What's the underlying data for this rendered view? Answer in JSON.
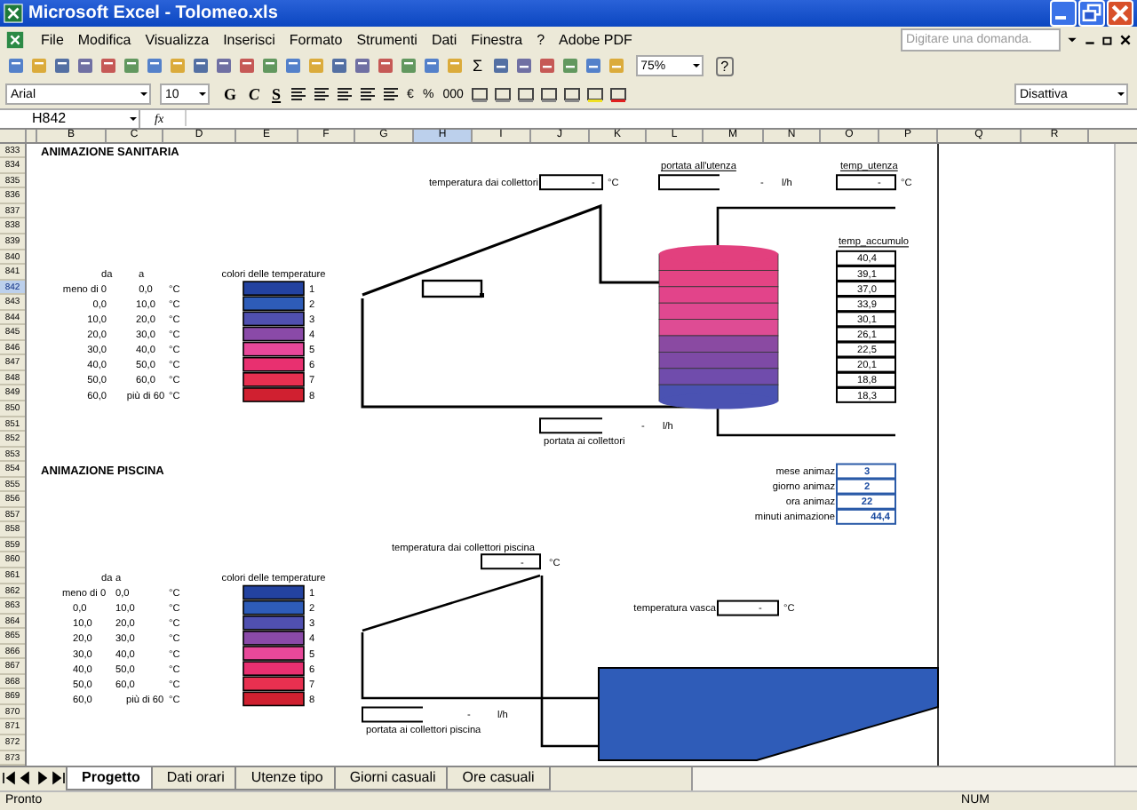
{
  "window": {
    "title": "Microsoft Excel - Tolomeo.xls"
  },
  "menu": [
    "File",
    "Modifica",
    "Visualizza",
    "Inserisci",
    "Formato",
    "Strumenti",
    "Dati",
    "Finestra",
    "?",
    "Adobe PDF"
  ],
  "help_search": {
    "placeholder": "Digitare una domanda."
  },
  "toolbar": {
    "sum": "Σ",
    "zoom": "75%",
    "help": "?"
  },
  "format_toolbar": {
    "font": "Arial",
    "size": "10",
    "styles": [
      "G",
      "C",
      "S"
    ],
    "number_formats": [
      "€",
      "%",
      "000"
    ],
    "style_box": "Disattiva"
  },
  "formula_bar": {
    "name_box": "H842",
    "fx": "fx"
  },
  "columns": [
    {
      "label": "B",
      "selected": false
    },
    {
      "label": "C",
      "selected": false
    },
    {
      "label": "D",
      "selected": false
    },
    {
      "label": "E",
      "selected": false
    },
    {
      "label": "F",
      "selected": false
    },
    {
      "label": "G",
      "selected": false
    },
    {
      "label": "H",
      "selected": true
    },
    {
      "label": "I",
      "selected": false
    },
    {
      "label": "J",
      "selected": false
    },
    {
      "label": "K",
      "selected": false
    },
    {
      "label": "L",
      "selected": false
    },
    {
      "label": "M",
      "selected": false
    },
    {
      "label": "N",
      "selected": false
    },
    {
      "label": "O",
      "selected": false
    },
    {
      "label": "P",
      "selected": false
    },
    {
      "label": "Q",
      "selected": false
    },
    {
      "label": "R",
      "selected": false
    }
  ],
  "rows": [
    {
      "label": "833",
      "selected": false
    },
    {
      "label": "834",
      "selected": false
    },
    {
      "label": "835",
      "selected": false
    },
    {
      "label": "836",
      "selected": false
    },
    {
      "label": "837",
      "selected": false
    },
    {
      "label": "838",
      "selected": false
    },
    {
      "label": "839",
      "selected": false
    },
    {
      "label": "840",
      "selected": false
    },
    {
      "label": "841",
      "selected": false
    },
    {
      "label": "842",
      "selected": true
    },
    {
      "label": "843",
      "selected": false
    },
    {
      "label": "844",
      "selected": false
    },
    {
      "label": "845",
      "selected": false
    },
    {
      "label": "846",
      "selected": false
    },
    {
      "label": "847",
      "selected": false
    },
    {
      "label": "848",
      "selected": false
    },
    {
      "label": "849",
      "selected": false
    },
    {
      "label": "850",
      "selected": false
    },
    {
      "label": "851",
      "selected": false
    },
    {
      "label": "852",
      "selected": false
    },
    {
      "label": "853",
      "selected": false
    },
    {
      "label": "854",
      "selected": false
    },
    {
      "label": "855",
      "selected": false
    },
    {
      "label": "856",
      "selected": false
    },
    {
      "label": "857",
      "selected": false
    },
    {
      "label": "858",
      "selected": false
    },
    {
      "label": "859",
      "selected": false
    },
    {
      "label": "860",
      "selected": false
    },
    {
      "label": "861",
      "selected": false
    },
    {
      "label": "862",
      "selected": false
    },
    {
      "label": "863",
      "selected": false
    },
    {
      "label": "864",
      "selected": false
    },
    {
      "label": "865",
      "selected": false
    },
    {
      "label": "866",
      "selected": false
    },
    {
      "label": "867",
      "selected": false
    },
    {
      "label": "868",
      "selected": false
    },
    {
      "label": "869",
      "selected": false
    },
    {
      "label": "870",
      "selected": false
    },
    {
      "label": "871",
      "selected": false
    },
    {
      "label": "872",
      "selected": false
    },
    {
      "label": "873",
      "selected": false
    }
  ],
  "sanitaria": {
    "title": "ANIMAZIONE SANITARIA",
    "legend": {
      "from_header": "da",
      "to_header": "a",
      "colors_header": "colori delle temperature",
      "ranges": [
        {
          "from": "meno di 0",
          "to": "0,0",
          "unit": "°C",
          "index": "1",
          "color": "#2342a0"
        },
        {
          "from": "0,0",
          "to": "10,0",
          "unit": "°C",
          "index": "2",
          "color": "#2e5cb8"
        },
        {
          "from": "10,0",
          "to": "20,0",
          "unit": "°C",
          "index": "3",
          "color": "#5050b0"
        },
        {
          "from": "20,0",
          "to": "30,0",
          "unit": "°C",
          "index": "4",
          "color": "#8a4aa8"
        },
        {
          "from": "30,0",
          "to": "40,0",
          "unit": "°C",
          "index": "5",
          "color": "#e8489a"
        },
        {
          "from": "40,0",
          "to": "50,0",
          "unit": "°C",
          "index": "6",
          "color": "#e83070"
        },
        {
          "from": "50,0",
          "to": "60,0",
          "unit": "°C",
          "index": "7",
          "color": "#e83050"
        },
        {
          "from": "60,0",
          "to": "più di 60",
          "unit": "°C",
          "index": "8",
          "color": "#d02030"
        }
      ]
    },
    "collector_temp": {
      "label": "temperatura dai collettori",
      "value": "-",
      "unit": "°C"
    },
    "user_flow": {
      "label": "portata all'utenza",
      "value": "-",
      "unit": "l/h"
    },
    "user_temp": {
      "label": "temp_utenza",
      "value": "-",
      "unit": "°C"
    },
    "storage": {
      "label": "temp_accumulo",
      "values": [
        "40,4",
        "39,1",
        "37,0",
        "33,9",
        "30,1",
        "26,1",
        "22,5",
        "20,1",
        "18,8",
        "18,3"
      ]
    },
    "collector_flow": {
      "label": "portata ai collettori",
      "value": "-",
      "unit": "l/h"
    }
  },
  "piscina": {
    "title": "ANIMAZIONE PISCINA",
    "animation": [
      {
        "label": "mese animaz",
        "value": "3"
      },
      {
        "label": "giorno animaz",
        "value": "2"
      },
      {
        "label": "ora animaz",
        "value": "22"
      },
      {
        "label": "minuti animazione",
        "value": "44,4"
      }
    ],
    "legend": {
      "from_header": "da",
      "to_header": "a",
      "colors_header": "colori delle temperature",
      "ranges": [
        {
          "from": "meno di 0",
          "to": "0,0",
          "unit": "°C",
          "index": "1",
          "color": "#2342a0"
        },
        {
          "from": "0,0",
          "to": "10,0",
          "unit": "°C",
          "index": "2",
          "color": "#2e5cb8"
        },
        {
          "from": "10,0",
          "to": "20,0",
          "unit": "°C",
          "index": "3",
          "color": "#5050b0"
        },
        {
          "from": "20,0",
          "to": "30,0",
          "unit": "°C",
          "index": "4",
          "color": "#8a4aa8"
        },
        {
          "from": "30,0",
          "to": "40,0",
          "unit": "°C",
          "index": "5",
          "color": "#e8489a"
        },
        {
          "from": "40,0",
          "to": "50,0",
          "unit": "°C",
          "index": "6",
          "color": "#e83070"
        },
        {
          "from": "50,0",
          "to": "60,0",
          "unit": "°C",
          "index": "7",
          "color": "#e83050"
        },
        {
          "from": "60,0",
          "to": "più di 60",
          "unit": "°C",
          "index": "8",
          "color": "#d02030"
        }
      ]
    },
    "collector_temp": {
      "label": "temperatura dai collettori piscina",
      "value": "-",
      "unit": "°C"
    },
    "pool_temp": {
      "label": "temperatura vasca",
      "value": "-",
      "unit": "°C"
    },
    "collector_flow": {
      "label": "portata ai collettori piscina",
      "value": "-",
      "unit": "l/h"
    }
  },
  "sheet_tabs": [
    {
      "label": "Progetto",
      "selected": true
    },
    {
      "label": "Dati orari",
      "selected": false
    },
    {
      "label": "Utenze tipo",
      "selected": false
    },
    {
      "label": "Giorni casuali",
      "selected": false
    },
    {
      "label": "Ore casuali",
      "selected": false
    }
  ],
  "status_bar": {
    "left": "Pronto",
    "right": "NUM"
  }
}
